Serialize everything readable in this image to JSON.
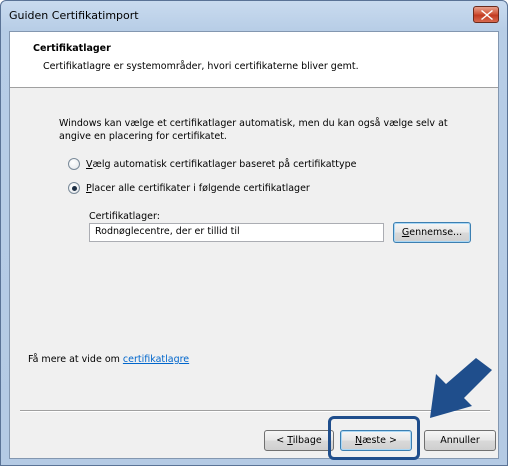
{
  "window": {
    "title": "Guiden Certifikatimport"
  },
  "header": {
    "title": "Certifikatlager",
    "description": "Certifikatlagre er systemområder, hvori certifikaterne bliver gemt."
  },
  "body": {
    "intro_line1": "Windows kan vælge et certifikatlager automatisk, men du kan også vælge selv at",
    "intro_line2": "angive en placering for certifikatet.",
    "radio_auto": {
      "accel": "V",
      "rest": "ælg automatisk certifikatlager baseret på certifikattype",
      "checked": false
    },
    "radio_place": {
      "accel": "P",
      "rest": "lacer alle certifikater i følgende certifikatlager",
      "checked": true
    },
    "store_label": "Certifikatlager:",
    "store_value": "Rodnøglecentre, der er tillid til",
    "browse": {
      "accel": "G",
      "rest": "ennemse..."
    }
  },
  "footer": {
    "more_text": "Få mere at vide om ",
    "more_link": "certifikatlagre",
    "back": {
      "prefix": "< ",
      "accel": "T",
      "rest": "ilbage"
    },
    "next": {
      "accel": "N",
      "rest": "æste >"
    },
    "cancel": "Annuller"
  },
  "colors": {
    "highlight": "#1f4e8c",
    "link": "#0066cc"
  },
  "icons": {
    "close": "close-icon",
    "pointer": "arrow-pointer-icon"
  }
}
